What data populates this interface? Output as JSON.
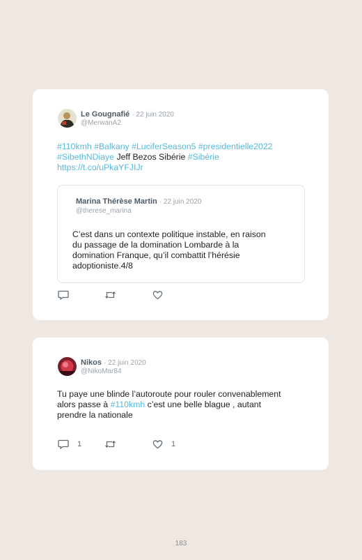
{
  "tweets": [
    {
      "author": "Le Gougnafié",
      "date": "· 22 juin 2020",
      "handle": "@MerwanA2",
      "lines": [
        [
          {
            "t": "#110kmh",
            "tag": true
          },
          {
            "t": " ",
            "tag": false
          },
          {
            "t": "#Balkany",
            "tag": true
          },
          {
            "t": " ",
            "tag": false
          },
          {
            "t": "#LuciferSeason5",
            "tag": true
          },
          {
            "t": " ",
            "tag": false
          },
          {
            "t": "#presidentielle2022",
            "tag": true
          }
        ],
        [
          {
            "t": "#SibethNDiaye",
            "tag": true
          },
          {
            "t": " Jeff Bezos Sibérie ",
            "tag": false
          },
          {
            "t": "#Sibérie",
            "tag": true
          }
        ],
        [
          {
            "t": "https://t.co/uPkaYFJIJr",
            "tag": true
          }
        ]
      ],
      "quote": {
        "author": "Marina Thérèse Martin",
        "date": "· 22 juin 2020",
        "handle": "@therese_marina",
        "lines": [
          "C’est dans un contexte politique instable, en raison",
          "du passage de la domination Lombarde à la",
          "domination Franque, qu’il combattit l’hérésie",
          "adoptioniste.4/8"
        ]
      },
      "reply_count": "",
      "retweet_count": "",
      "like_count": ""
    },
    {
      "author": "Nikos",
      "date": "· 22 juin 2020",
      "handle": "@NikoMar84",
      "lines": [
        [
          {
            "t": "Tu paye une blinde l’autoroute pour rouler convenablement",
            "tag": false
          }
        ],
        [
          {
            "t": "alors passe à ",
            "tag": false
          },
          {
            "t": "#110kmh",
            "tag": true
          },
          {
            "t": " c’est une belle blague , autant",
            "tag": false
          }
        ],
        [
          {
            "t": "prendre la nationale",
            "tag": false
          }
        ]
      ],
      "reply_count": "1",
      "retweet_count": "",
      "like_count": "1"
    }
  ],
  "icons": {
    "reply": "reply-icon",
    "retweet": "retweet-icon",
    "like": "heart-icon"
  },
  "colors": {
    "background": "#efe7e2",
    "card": "#ffffff",
    "hashtag": "#56b8dd",
    "name": "#4d5a66",
    "muted": "#9aa4ad"
  },
  "page_number": "183"
}
